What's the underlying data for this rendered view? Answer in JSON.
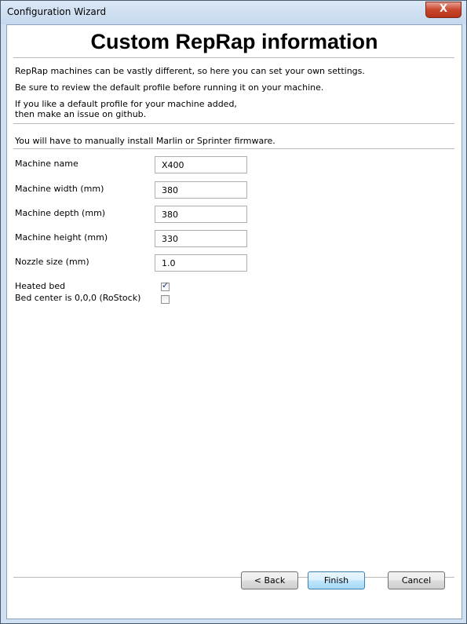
{
  "window": {
    "title": "Configuration Wizard",
    "close_label": "X"
  },
  "page": {
    "heading": "Custom RepRap information",
    "intro_lines": [
      "RepRap machines can be vastly different, so here you can set your own settings.",
      "Be sure to review the default profile before running it on your machine.",
      "If you like a default profile for your machine added,",
      "then make an issue on github."
    ],
    "firmware_note": "You will have to manually install Marlin or Sprinter firmware."
  },
  "fields": [
    {
      "label": "Machine name",
      "value": "X400"
    },
    {
      "label": "Machine width (mm)",
      "value": "380"
    },
    {
      "label": "Machine depth (mm)",
      "value": "380"
    },
    {
      "label": "Machine height (mm)",
      "value": "330"
    },
    {
      "label": "Nozzle size (mm)",
      "value": "1.0"
    }
  ],
  "checkboxes": [
    {
      "label": "Heated bed",
      "checked": true
    },
    {
      "label": "Bed center is 0,0,0 (RoStock)",
      "checked": false
    }
  ],
  "buttons": {
    "back": "< Back",
    "finish": "Finish",
    "cancel": "Cancel"
  }
}
